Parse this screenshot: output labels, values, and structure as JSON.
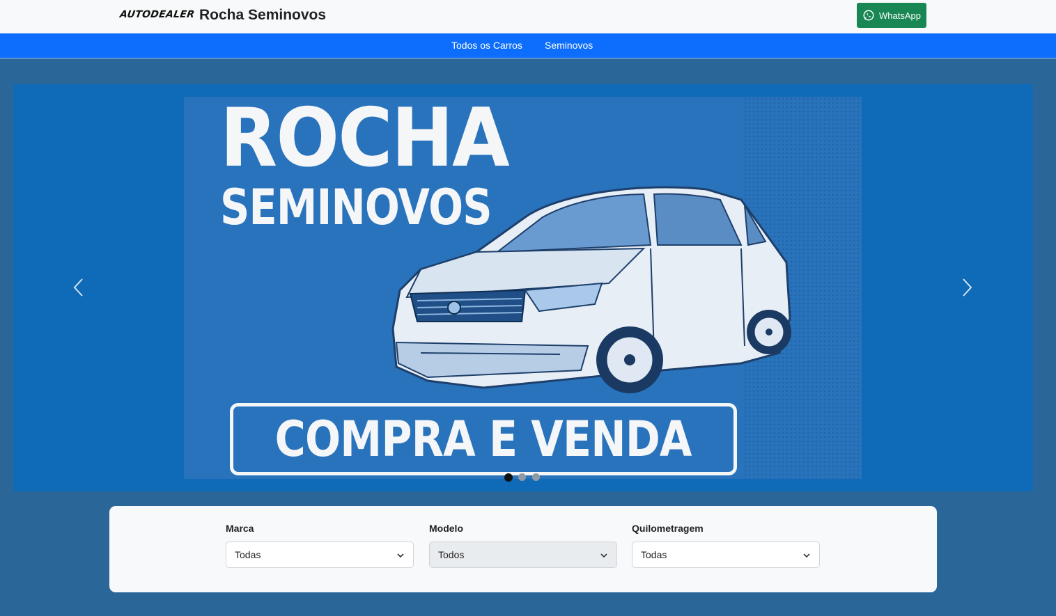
{
  "header": {
    "logo_text": "AUTODEALER",
    "title": "Rocha Seminovos",
    "whatsapp_label": "WhatsApp"
  },
  "nav": {
    "items": [
      "Todos os Carros",
      "Seminovos"
    ]
  },
  "banner": {
    "title_line1": "ROCHA",
    "title_line2": "SEMINOVOS",
    "cta": "COMPRA E VENDA"
  },
  "carousel": {
    "slides": 3,
    "active": 1
  },
  "filters": {
    "marca": {
      "label": "Marca",
      "value": "Todas"
    },
    "modelo": {
      "label": "Modelo",
      "value": "Todos",
      "disabled": true
    },
    "quilometragem": {
      "label": "Quilometragem",
      "value": "Todas"
    }
  },
  "colors": {
    "page_bg": "#2a6698",
    "nav_bg": "#0d6efd",
    "whatsapp": "#198754",
    "hero_bg": "#0f6ab8"
  }
}
